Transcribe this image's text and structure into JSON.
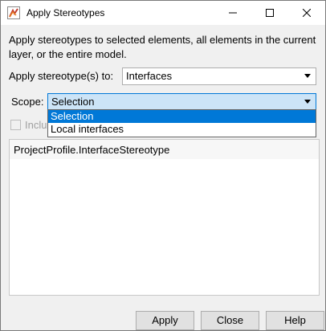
{
  "window": {
    "title": "Apply Stereotypes"
  },
  "description": "Apply stereotypes to selected elements, all elements in the current layer, or the entire model.",
  "stereotype_row": {
    "label": "Apply stereotype(s) to:",
    "value": "Interfaces"
  },
  "scope_row": {
    "label": "Scope:",
    "value": "Selection",
    "options": [
      "Selection",
      "Local interfaces"
    ],
    "selected_index": 0
  },
  "checkbox": {
    "label": "Inclu",
    "checked": false,
    "enabled": false
  },
  "list": {
    "items": [
      "ProjectProfile.InterfaceStereotype"
    ]
  },
  "buttons": {
    "apply": "Apply",
    "close": "Close",
    "help": "Help"
  },
  "colors": {
    "accent": "#0078d7",
    "focus_bg": "#cce4f7"
  }
}
